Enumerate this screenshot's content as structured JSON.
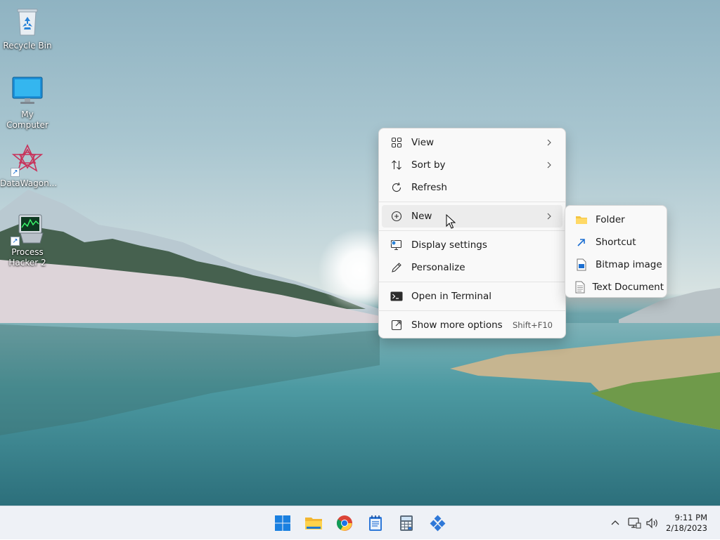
{
  "desktop": {
    "icons": [
      {
        "label": "Recycle Bin"
      },
      {
        "label": "My Computer"
      },
      {
        "label": "DataWagon..."
      },
      {
        "label": "Process Hacker 2"
      }
    ]
  },
  "context_menu": {
    "items": [
      {
        "label": "View",
        "icon": "grid-view-icon",
        "has_submenu": true
      },
      {
        "label": "Sort by",
        "icon": "sort-arrows-icon",
        "has_submenu": true
      },
      {
        "label": "Refresh",
        "icon": "refresh-icon"
      },
      {
        "label": "New",
        "icon": "plus-circle-icon",
        "has_submenu": true,
        "highlighted": true
      },
      {
        "label": "Display settings",
        "icon": "display-settings-icon"
      },
      {
        "label": "Personalize",
        "icon": "pen-icon"
      },
      {
        "label": "Open in Terminal",
        "icon": "terminal-icon"
      },
      {
        "label": "Show more options",
        "icon": "more-options-icon",
        "shortcut": "Shift+F10"
      }
    ]
  },
  "new_submenu": {
    "items": [
      {
        "label": "Folder",
        "icon": "folder-icon"
      },
      {
        "label": "Shortcut",
        "icon": "shortcut-arrow-icon"
      },
      {
        "label": "Bitmap image",
        "icon": "bitmap-icon"
      },
      {
        "label": "Text Document",
        "icon": "text-document-icon"
      }
    ]
  },
  "taskbar": {
    "apps": [
      "start-icon",
      "file-explorer-icon",
      "chrome-icon",
      "notepad-icon",
      "calculator-icon",
      "app-blocks-icon"
    ],
    "tray": [
      "chevron-up-icon",
      "network-icon",
      "volume-icon"
    ],
    "time": "9:11 PM",
    "date": "2/18/2023"
  },
  "colors": {
    "accent": "#0067c0",
    "menu_bg": "#f9f9f9",
    "taskbar_bg": "#eef1f6"
  }
}
